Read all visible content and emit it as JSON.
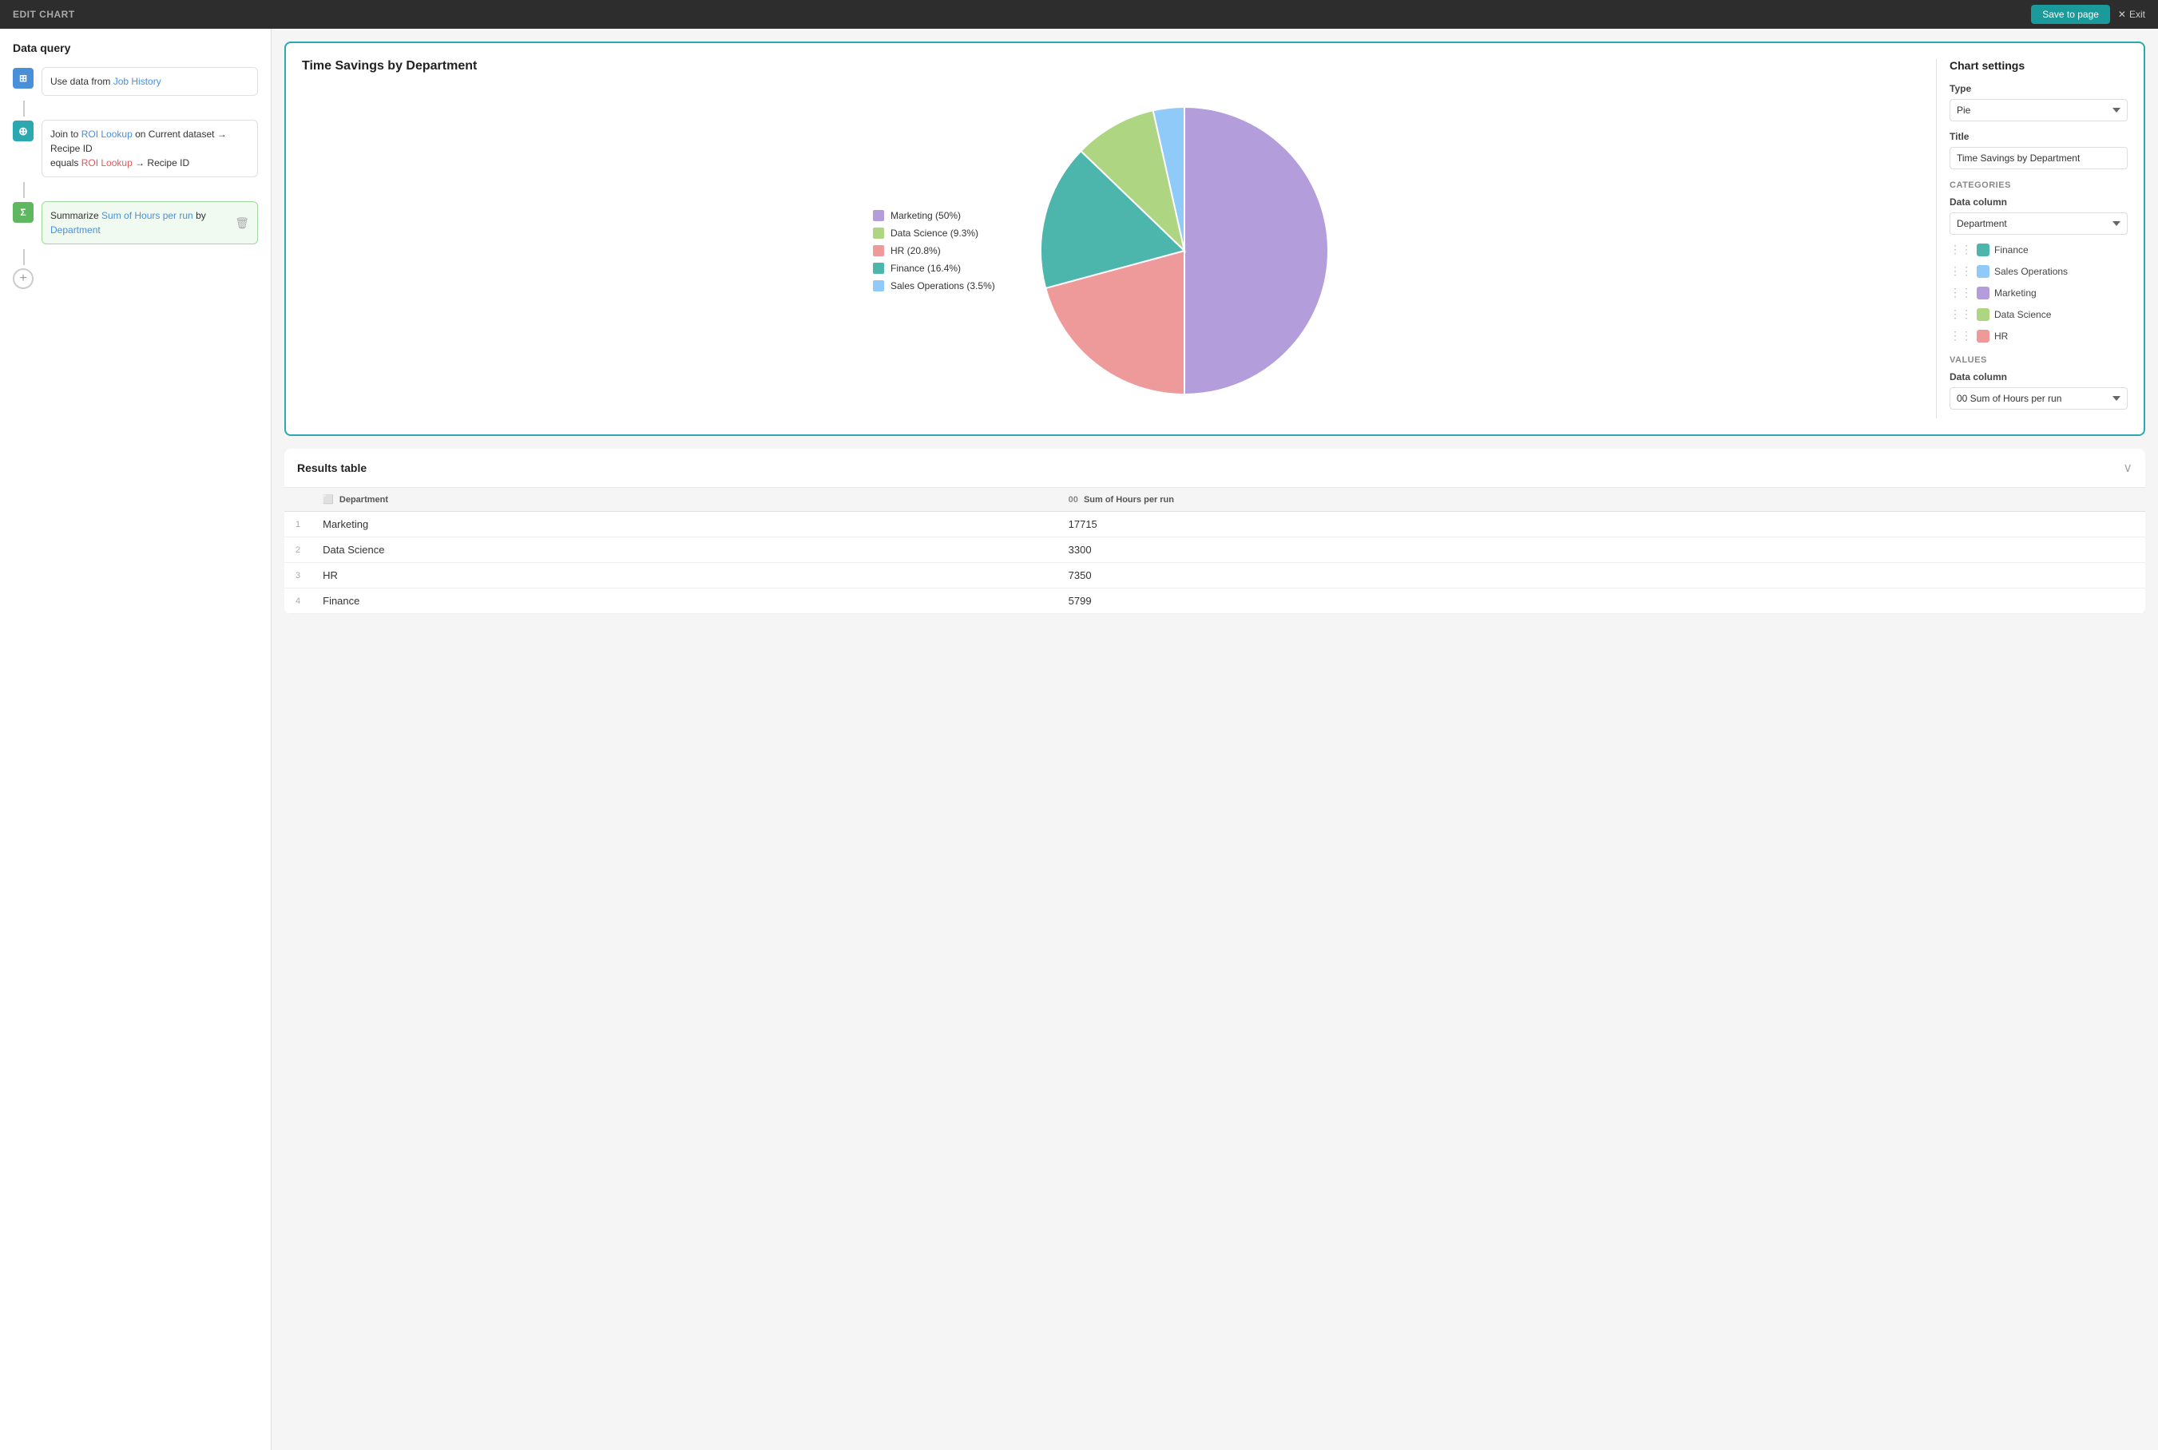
{
  "topbar": {
    "title": "EDIT CHART",
    "save_label": "Save to page",
    "exit_label": "Exit"
  },
  "left_panel": {
    "title": "Data query",
    "steps": [
      {
        "id": "use-data",
        "icon": "⊞",
        "icon_type": "blue",
        "text_prefix": "Use data from ",
        "link": "Job History",
        "link_color": "blue"
      },
      {
        "id": "join",
        "icon": "⊕",
        "icon_type": "teal",
        "text_prefix": "Join to ",
        "link1": "ROI Lookup",
        "link1_color": "blue",
        "text_on": " on ",
        "text_current": "Current dataset",
        "text_arrow": " → ",
        "text_recipe": "Recipe ID",
        "text_equals": "equals ",
        "link2": "ROI Lookup",
        "link2_color": "red",
        "text_arrow2": " → ",
        "text_recipe2": "Recipe ID"
      },
      {
        "id": "summarize",
        "icon": "Σ",
        "icon_type": "green",
        "text_prefix": "Summarize ",
        "link1": "Sum of Hours per run",
        "link1_color": "blue",
        "text_by": " by ",
        "link2": "Department",
        "link2_color": "blue",
        "active": true
      }
    ],
    "add_button_label": "+"
  },
  "chart": {
    "title": "Time Savings by Department",
    "settings_title": "Chart settings",
    "type_label": "Type",
    "type_value": "Pie",
    "title_label": "Title",
    "title_value": "Time Savings by Department",
    "categories_label": "CATEGORIES",
    "data_column_label": "Data column",
    "categories_column": "Department",
    "values_label": "VALUES",
    "values_column_label": "Data column",
    "values_column": "Sum of Hours per run",
    "legend": [
      {
        "label": "Marketing (50%)",
        "color": "#b39ddb"
      },
      {
        "label": "Data Science (9.3%)",
        "color": "#aed581"
      },
      {
        "label": "HR (20.8%)",
        "color": "#ef9a9a"
      },
      {
        "label": "Finance (16.4%)",
        "color": "#4db6ac"
      },
      {
        "label": "Sales Operations (3.5%)",
        "color": "#90caf9"
      }
    ],
    "categories": [
      {
        "label": "Finance",
        "color": "#4db6ac"
      },
      {
        "label": "Sales Operations",
        "color": "#90caf9"
      },
      {
        "label": "Marketing",
        "color": "#b39ddb"
      },
      {
        "label": "Data Science",
        "color": "#aed581"
      },
      {
        "label": "HR",
        "color": "#ef9a9a"
      }
    ],
    "pie_segments": [
      {
        "label": "Marketing",
        "percent": 50,
        "color": "#b39ddb"
      },
      {
        "label": "HR",
        "percent": 20.8,
        "color": "#ef9a9a"
      },
      {
        "label": "Finance",
        "percent": 16.4,
        "color": "#4db6ac"
      },
      {
        "label": "Data Science",
        "percent": 9.3,
        "color": "#aed581"
      },
      {
        "label": "Sales Operations",
        "percent": 3.5,
        "color": "#90caf9"
      }
    ]
  },
  "results_table": {
    "title": "Results table",
    "col_department": "Department",
    "col_hours": "Sum of Hours per run",
    "rows": [
      {
        "num": 1,
        "department": "Marketing",
        "hours": "17715"
      },
      {
        "num": 2,
        "department": "Data Science",
        "hours": "3300"
      },
      {
        "num": 3,
        "department": "HR",
        "hours": "7350"
      },
      {
        "num": 4,
        "department": "Finance",
        "hours": "5799"
      }
    ]
  }
}
